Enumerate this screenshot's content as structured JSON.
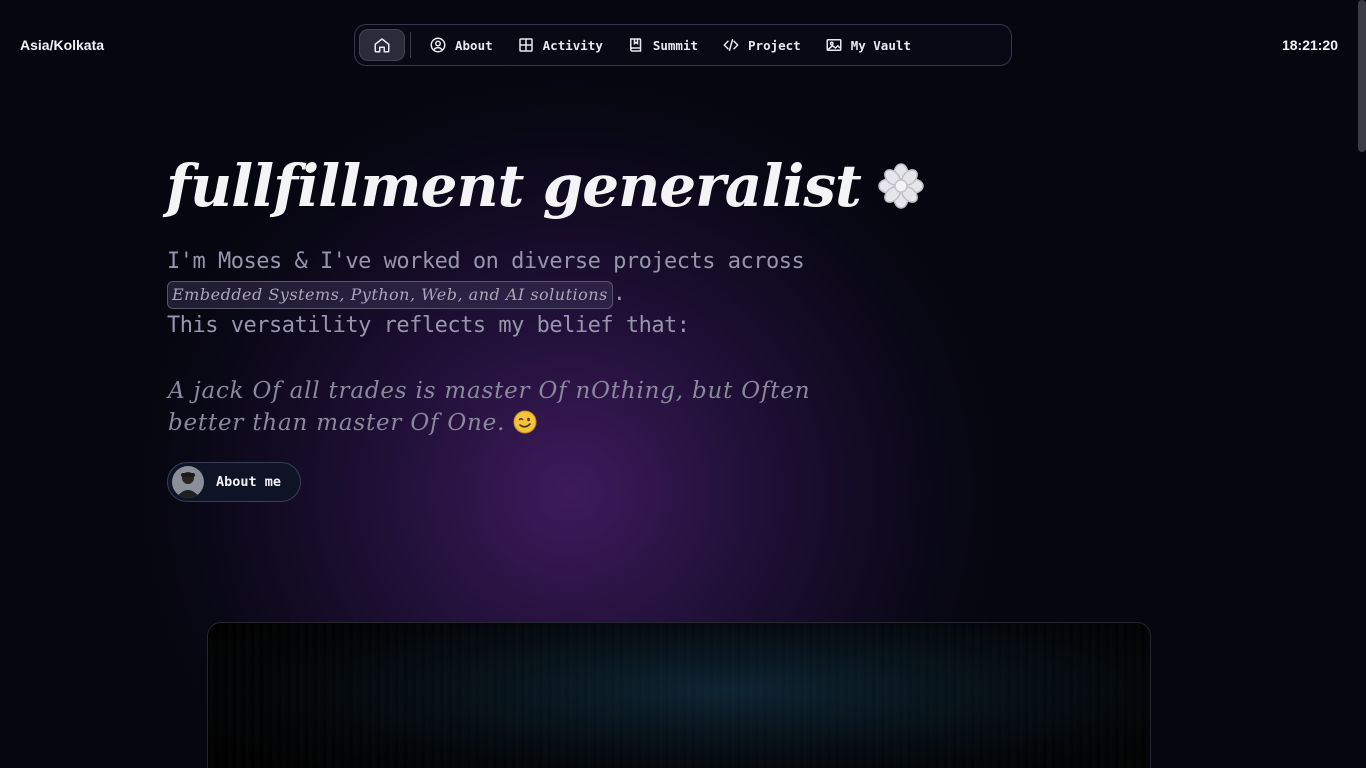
{
  "header": {
    "timezone": "Asia/Kolkata",
    "clock": "18:21:20"
  },
  "nav": {
    "home_icon": "home-icon",
    "items": [
      {
        "label": "About",
        "icon": "user-circle-icon"
      },
      {
        "label": "Activity",
        "icon": "grid-icon"
      },
      {
        "label": "Summit",
        "icon": "book-icon"
      },
      {
        "label": "Project",
        "icon": "code-icon"
      },
      {
        "label": "My Vault",
        "icon": "image-icon"
      }
    ]
  },
  "hero": {
    "title": "fullfillment generalist",
    "intro_line1": "I'm Moses & I've worked on diverse projects across",
    "skills": "Embedded Systems, Python, Web, and AI solutions",
    "skills_suffix": ".",
    "intro_line2": "This versatility reflects my belief that:",
    "quote": "A jack Of all trades is master Of nOthing, but Often better than master Of One."
  },
  "about_button": {
    "label": "About me"
  },
  "colors": {
    "background": "#05060f",
    "glow": "#3a1a5c",
    "text_muted": "#9795ab"
  }
}
